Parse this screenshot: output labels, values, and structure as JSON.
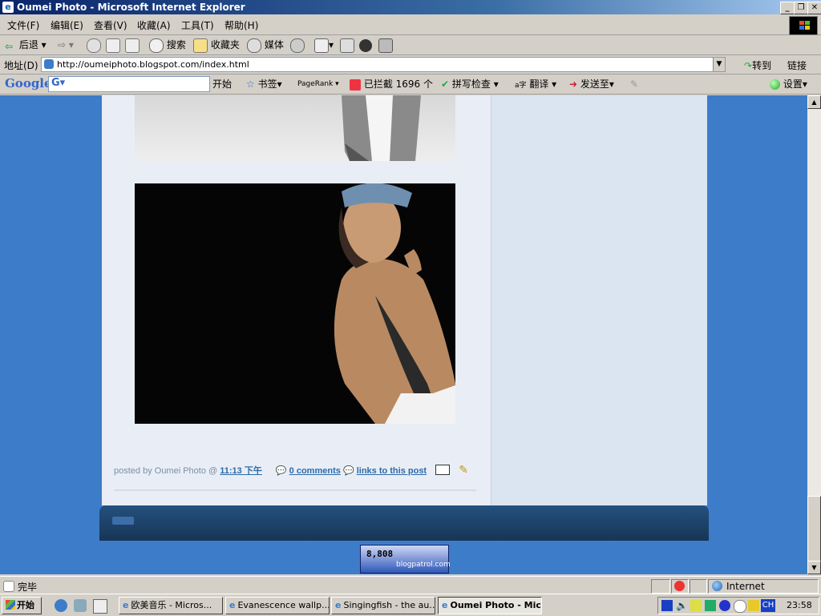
{
  "window": {
    "title": "Oumei Photo - Microsoft Internet Explorer"
  },
  "menu": [
    "文件(F)",
    "编辑(E)",
    "查看(V)",
    "收藏(A)",
    "工具(T)",
    "帮助(H)"
  ],
  "toolbar": {
    "back_label": "后退",
    "search_label": "搜索",
    "favorites_label": "收藏夹",
    "media_label": "媒体"
  },
  "address": {
    "label": "地址(D)",
    "url": "http://oumeiphoto.blogspot.com/index.html",
    "go_label": "转到",
    "links_label": "链接"
  },
  "google_toolbar": {
    "logo": "Google",
    "start_label": "开始",
    "bookmarks_label": "书签",
    "pagerank_label": "PageRank",
    "blocked_label": "已拦截 1696 个",
    "spellcheck_label": "拼写检查",
    "translate_label": "翻译",
    "sendto_label": "发送至",
    "settings_label": "设置"
  },
  "post": {
    "posted_by": "posted by Oumei Photo @",
    "time": "11:13 下午",
    "comments": "0 comments",
    "links": "links to this post"
  },
  "counter": {
    "value": "8,808",
    "site": "blogpatrol.com"
  },
  "status": {
    "text": "完毕",
    "zone": "Internet"
  },
  "taskbar": {
    "start_label": "开始",
    "tasks": [
      "欧美音乐 - Micros...",
      "Evanescence wallp...",
      "Singingfish - the au...",
      "Oumei Photo - Micr..."
    ],
    "lang": "CH",
    "clock": "23:58"
  }
}
